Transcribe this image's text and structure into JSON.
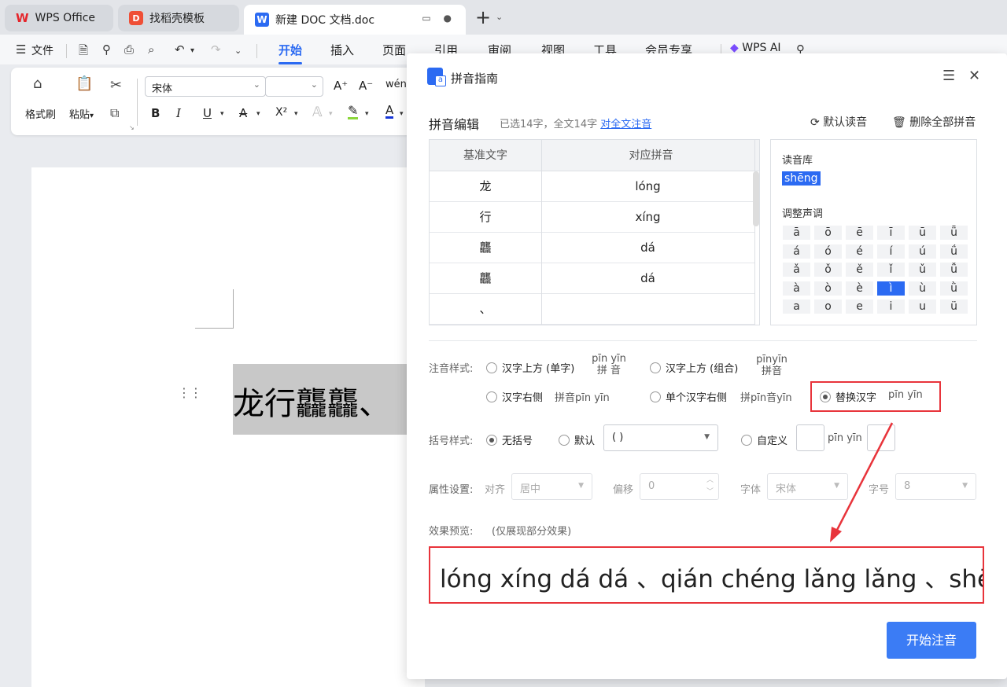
{
  "titlebar": {
    "tabs": [
      {
        "label": "WPS Office",
        "logo": "W"
      },
      {
        "label": "找稻壳模板",
        "logo": "D"
      },
      {
        "label": "新建 DOC 文档.doc",
        "logo": "W"
      }
    ],
    "new_tab": "+",
    "tab_extra": "▭ ●"
  },
  "menubar": {
    "file": "文件",
    "items": [
      "开始",
      "插入",
      "页面",
      "引用",
      "审阅",
      "视图",
      "工具",
      "会员专享"
    ],
    "wps_ai": "WPS AI"
  },
  "ribbon": {
    "format_painter": "格式刷",
    "paste": "粘贴",
    "font_name": "宋体",
    "font_size": "",
    "bold": "B",
    "italic": "I",
    "underline": "U",
    "strike": "A",
    "superscript": "X²",
    "grow": "A⁺",
    "shrink": "A⁻",
    "pinyin": "wén",
    "color": "A"
  },
  "document": {
    "text": "龙行龘龘、"
  },
  "dialog": {
    "title": "拼音指南",
    "edit_title": "拼音编辑",
    "selection_info": "已选14字，全文14字",
    "annotate_all": "对全文注音",
    "default_reading": "默认读音",
    "delete_all": "删除全部拼音",
    "table": {
      "headers": [
        "基准文字",
        "对应拼音"
      ],
      "rows": [
        {
          "char": "龙",
          "pinyin": "lóng"
        },
        {
          "char": "行",
          "pinyin": "xíng"
        },
        {
          "char": "龘",
          "pinyin": "dá"
        },
        {
          "char": "龘",
          "pinyin": "dá"
        },
        {
          "char": "、",
          "pinyin": ""
        }
      ]
    },
    "tone_panel": {
      "library_label": "读音库",
      "selected_reading": "shēng",
      "adjust_label": "调整声调",
      "grid": [
        [
          "ā",
          "ō",
          "ē",
          "ī",
          "ū",
          "ǖ"
        ],
        [
          "á",
          "ó",
          "é",
          "í",
          "ú",
          "ǘ"
        ],
        [
          "ǎ",
          "ǒ",
          "ě",
          "ǐ",
          "ǔ",
          "ǚ"
        ],
        [
          "à",
          "ò",
          "è",
          "ì",
          "ù",
          "ǜ"
        ],
        [
          "a",
          "o",
          "e",
          "i",
          "u",
          "ü"
        ]
      ],
      "selected_tone": "ì"
    },
    "style": {
      "label": "注音样式:",
      "above_single": "汉字上方 (单字)",
      "above_single_ex_py": "pīn yīn",
      "above_single_ex_hz": "拼 音",
      "above_group": "汉字上方 (组合)",
      "above_group_ex_py": "pīnyīn",
      "above_group_ex_hz": "拼音",
      "right": "汉字右侧",
      "right_ex": "拼音pīn yīn",
      "single_right": "单个汉字右侧",
      "single_right_ex": "拼pīn音yīn",
      "replace": "替换汉字",
      "replace_ex": "pīn yīn"
    },
    "bracket": {
      "label": "括号样式:",
      "none": "无括号",
      "default": "默认",
      "default_value": "( )",
      "custom": "自定义",
      "custom_ex": "pīn yīn"
    },
    "props": {
      "label": "属性设置:",
      "align_label": "对齐",
      "align_value": "居中",
      "offset_label": "偏移",
      "offset_value": "0",
      "font_label": "字体",
      "font_value": "宋体",
      "size_label": "字号",
      "size_value": "8"
    },
    "preview": {
      "label": "效果预览:",
      "note": "(仅展现部分效果)",
      "text": "lóng xíng dá dá 、qián chéng lǎng lǎng 、shēng"
    },
    "start_button": "开始注音"
  },
  "colors": {
    "accent": "#2b6af2",
    "highlight": "#e8343b"
  }
}
